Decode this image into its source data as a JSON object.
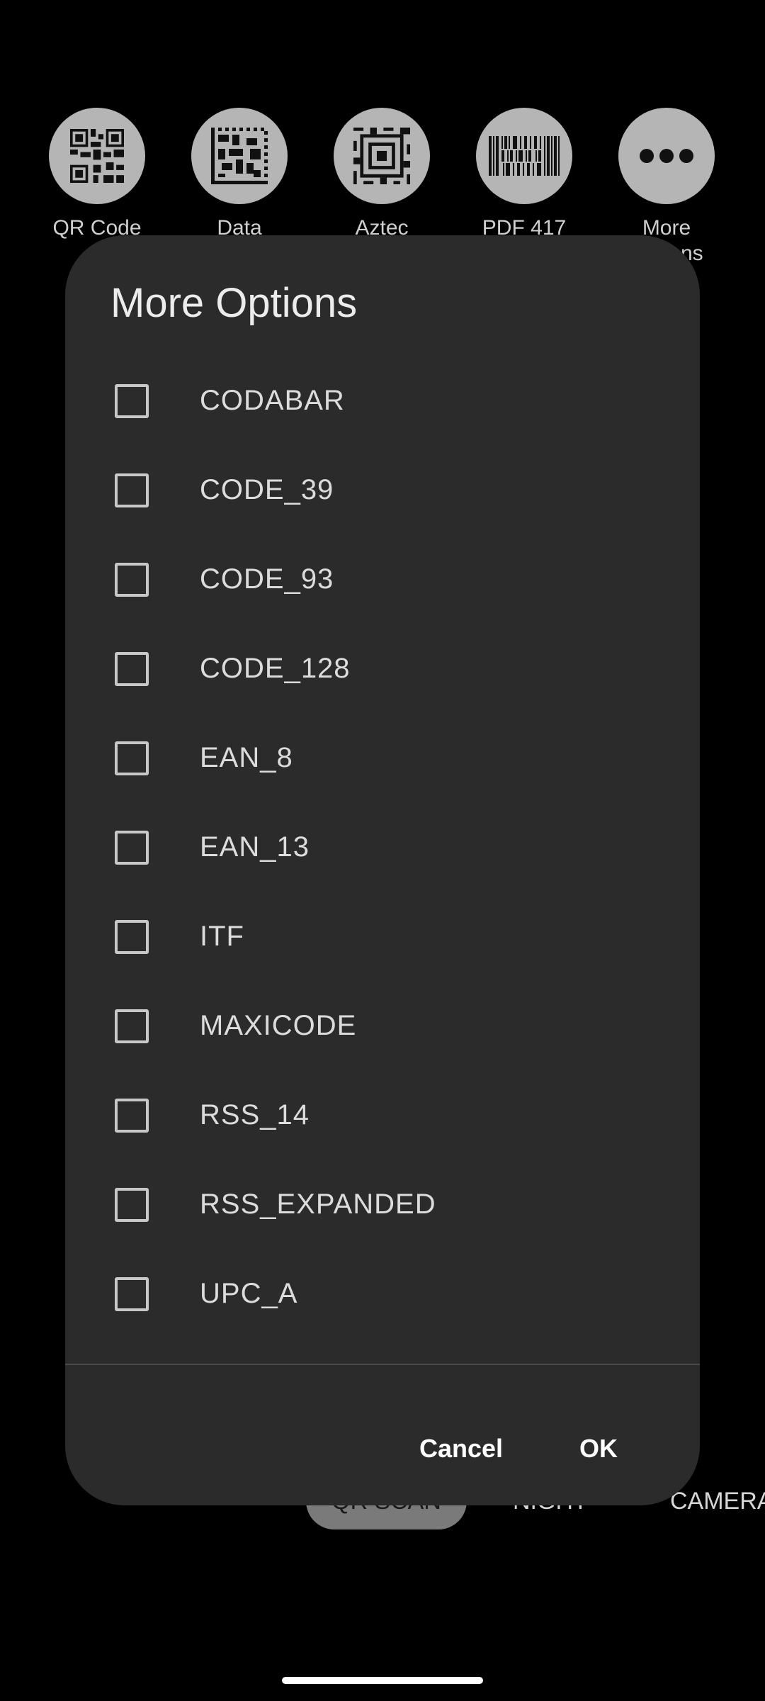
{
  "background": {
    "code_types": [
      {
        "label": "QR Code",
        "icon": "qr-code-icon"
      },
      {
        "label": "Data",
        "icon": "data-matrix-icon"
      },
      {
        "label": "Aztec",
        "icon": "aztec-icon"
      },
      {
        "label": "PDF 417",
        "icon": "pdf417-icon"
      },
      {
        "label": "More\nOptions",
        "icon": "more-dots-icon"
      }
    ],
    "modes": [
      "QR SCAN",
      "NIGHT",
      "CAMERA"
    ]
  },
  "dialog": {
    "title": "More Options",
    "options": [
      {
        "label": "CODABAR",
        "checked": false
      },
      {
        "label": "CODE_39",
        "checked": false
      },
      {
        "label": "CODE_93",
        "checked": false
      },
      {
        "label": "CODE_128",
        "checked": false
      },
      {
        "label": "EAN_8",
        "checked": false
      },
      {
        "label": "EAN_13",
        "checked": false
      },
      {
        "label": "ITF",
        "checked": false
      },
      {
        "label": "MAXICODE",
        "checked": false
      },
      {
        "label": "RSS_14",
        "checked": false
      },
      {
        "label": "RSS_EXPANDED",
        "checked": false
      },
      {
        "label": "UPC_A",
        "checked": false
      }
    ],
    "cancel_label": "Cancel",
    "ok_label": "OK"
  },
  "colors": {
    "dialog_bg": "#2b2b2b",
    "screen_bg": "#000000",
    "icon_circle": "#b5b5b5"
  }
}
